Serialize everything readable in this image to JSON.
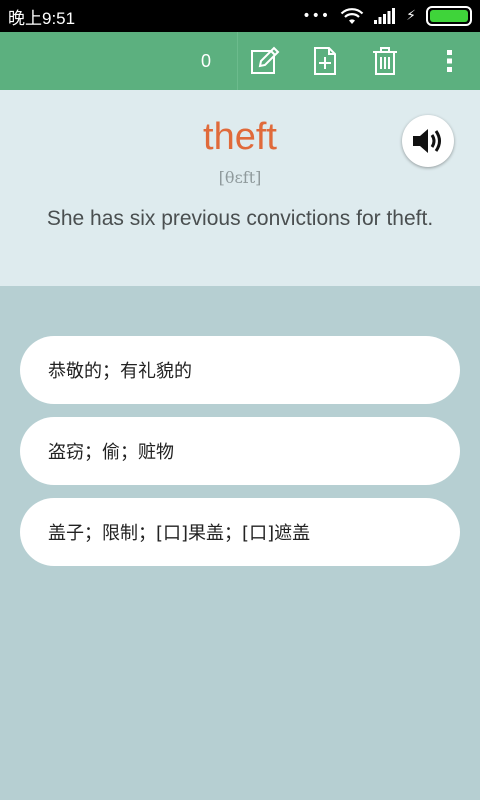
{
  "status_bar": {
    "time": "晚上9:51",
    "dots": "•••",
    "signal_icon": "wifi-icon",
    "cell_icon": "cell-signal-icon",
    "charging_icon": "charging-bolt-icon",
    "battery_level": 1.0
  },
  "toolbar": {
    "counter": "0",
    "icons": [
      "edit-icon",
      "new-document-icon",
      "trash-icon",
      "more-vert-icon"
    ],
    "color": "#5cb07f"
  },
  "card": {
    "word": "theft",
    "phonetic": "[θɛft]",
    "example": "She has six previous convictions for theft.",
    "speaker_icon": "speaker-icon",
    "word_color": "#e06a3a"
  },
  "options": [
    {
      "label": "恭敬的；有礼貌的"
    },
    {
      "label": "盗窃；偷；赃物"
    },
    {
      "label": "盖子；限制；[口]果盖；[口]遮盖"
    }
  ],
  "colors": {
    "background": "#b6cfd2",
    "panel": "#deebee"
  }
}
